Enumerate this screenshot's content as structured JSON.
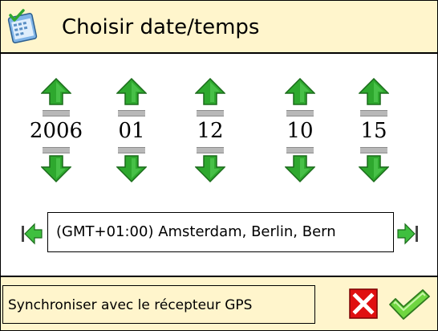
{
  "title": "Choisir date/temps",
  "fields": [
    {
      "value": "2006"
    },
    {
      "value": "01"
    },
    {
      "value": "12"
    },
    {
      "value": "10"
    },
    {
      "value": "15"
    }
  ],
  "timezone": "(GMT+01:00) Amsterdam, Berlin, Bern",
  "gps_label": "Synchroniser avec le récepteur GPS",
  "icons": {
    "title": "calendar-icon",
    "up": "arrow-up-icon",
    "down": "arrow-down-icon",
    "left": "arrow-left-icon",
    "right": "arrow-right-icon",
    "cancel": "close-icon",
    "ok": "checkmark-icon"
  },
  "colors": {
    "header_bg": "#fff5cc",
    "arrow_green": "#2ea82e",
    "cancel_red": "#e01010",
    "ok_green": "#6fd640"
  }
}
